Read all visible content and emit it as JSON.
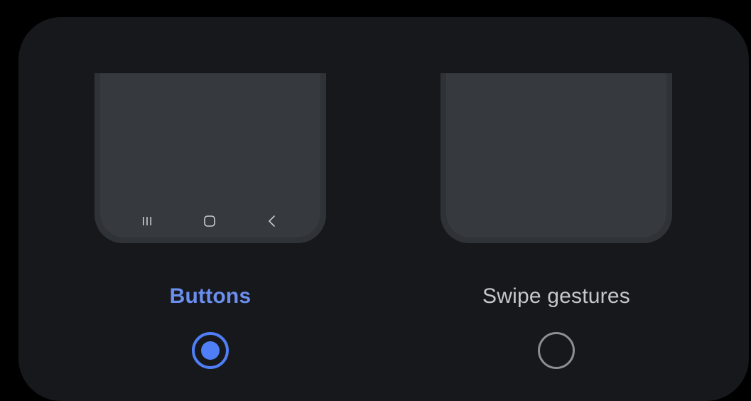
{
  "options": [
    {
      "label": "Buttons",
      "selected": true,
      "nav_icons": [
        "recents-icon",
        "home-icon",
        "back-icon"
      ]
    },
    {
      "label": "Swipe gestures",
      "selected": false,
      "nav_icons": []
    }
  ],
  "colors": {
    "accent": "#4f7ef7",
    "selected_label": "#6b8ff0",
    "unselected_label": "#c5c7ca",
    "card_background": "#17181b",
    "phone_preview": "#363a3e"
  }
}
